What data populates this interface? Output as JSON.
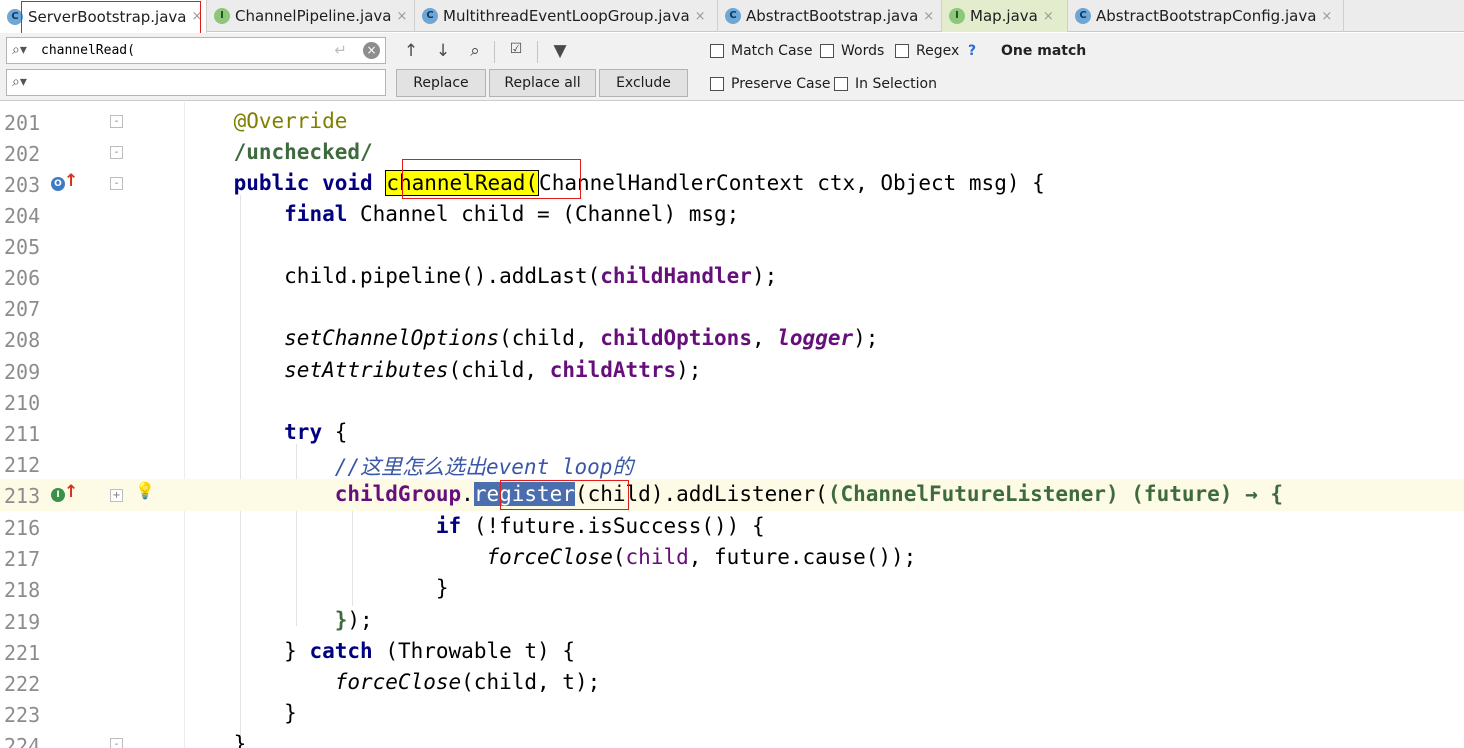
{
  "tabs": [
    {
      "label": "ServerBootstrap.java",
      "icon": "c",
      "active": true
    },
    {
      "label": "ChannelPipeline.java",
      "icon": "i"
    },
    {
      "label": "MultithreadEventLoopGroup.java",
      "icon": "c"
    },
    {
      "label": "AbstractBootstrap.java",
      "icon": "c"
    },
    {
      "label": "Map.java",
      "icon": "i"
    },
    {
      "label": "AbstractBootstrapConfig.java",
      "icon": "c"
    }
  ],
  "tab_close": "×",
  "find": {
    "search_value": "channelRead(",
    "replace_value": "",
    "replace_label": "Replace",
    "replace_all_label": "Replace all",
    "exclude_label": "Exclude",
    "match_case_label": "Match Case",
    "words_label": "Words",
    "regex_label": "Regex",
    "regex_help": "?",
    "preserve_case_label": "Preserve Case",
    "in_selection_label": "In Selection",
    "result_text": "One match"
  },
  "code": {
    "lines": [
      "201",
      "202",
      "203",
      "204",
      "205",
      "206",
      "207",
      "208",
      "209",
      "210",
      "211",
      "212",
      "213",
      "216",
      "217",
      "218",
      "219",
      "221",
      "222",
      "223",
      "224"
    ],
    "t201_override": "@Override",
    "t202_unchecked": "/unchecked/",
    "t203_public": "public",
    "t203_void": "void",
    "t203_method": "channelRead(",
    "t203_rest": "ChannelHandlerContext ctx, Object msg) {",
    "t204_final": "final",
    "t204_rest": " Channel child = (Channel) msg;",
    "t206_a": "child.pipeline().addLast(",
    "t206_field": "childHandler",
    "t206_b": ");",
    "t208_method": "setChannelOptions",
    "t208_a": "(child, ",
    "t208_field": "childOptions",
    "t208_b": ", ",
    "t208_logger": "logger",
    "t208_c": ");",
    "t209_method": "setAttributes",
    "t209_a": "(child, ",
    "t209_field": "childAttrs",
    "t209_b": ");",
    "t211_try": "try",
    "t211_brace": " {",
    "t212_comment": "//这里怎么选出event loop的",
    "t213_field": "childGroup",
    "t213_dot": ".",
    "t213_register": "register",
    "t213_a": "(child).addListener(",
    "t213_lambda": "(ChannelFutureListener) (future) → {",
    "t216_if": "if",
    "t216_rest": " (!future.isSuccess()) {",
    "t217_method": "forceClose",
    "t217_a": "(",
    "t217_child": "child",
    "t217_b": ", future.cause());",
    "t218_brace": "}",
    "t219_brace": "}",
    "t219_rest": ");",
    "t221_a": "} ",
    "t221_catch": "catch",
    "t221_b": " (Throwable t) {",
    "t222_method": "forceClose",
    "t222_a": "(child, t);",
    "t223_brace": "}",
    "t224_brace": "}"
  }
}
